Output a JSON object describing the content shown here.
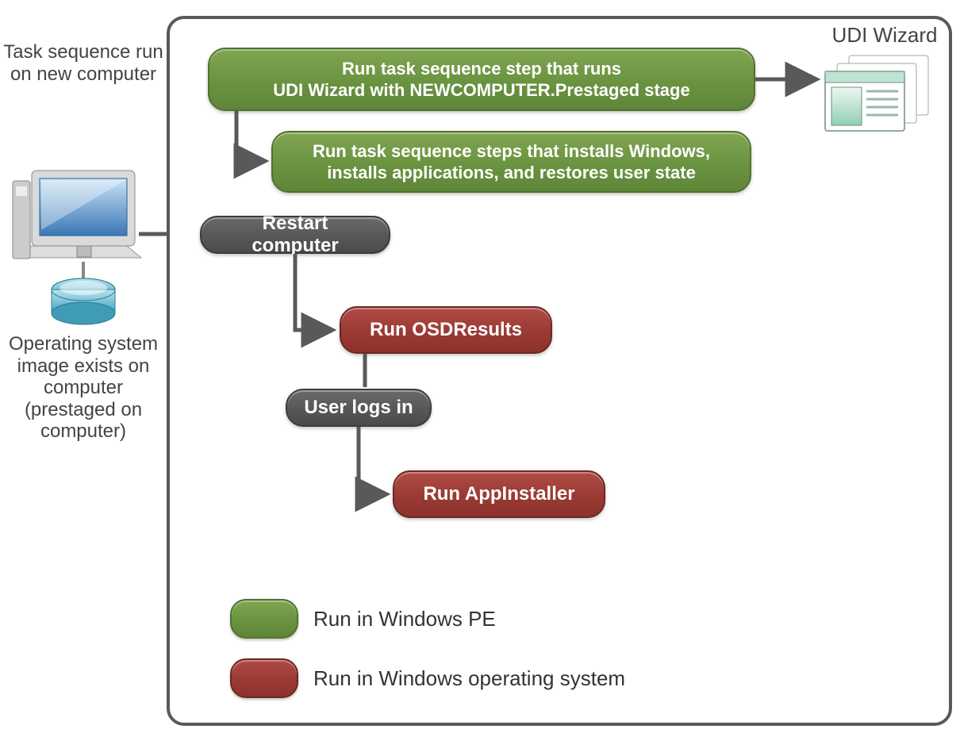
{
  "labels": {
    "task_sequence": "Task sequence run on new computer",
    "os_image": "Operating system image exists on computer (prestaged on computer)",
    "udi_wizard": "UDI Wizard"
  },
  "steps": {
    "green1_line1": "Run task sequence step  that runs",
    "green1_line2": "UDI Wizard with NEWCOMPUTER.Prestaged  stage",
    "green2_line1": "Run task sequence steps that installs Windows,",
    "green2_line2": "installs applications, and restores user state",
    "restart": "Restart computer",
    "osd": "Run OSDResults",
    "login": "User logs in",
    "appinstaller": "Run AppInstaller"
  },
  "legend": {
    "pe": "Run in Windows  PE",
    "os": "Run in Windows operating system"
  },
  "colors": {
    "green": "#6d9342",
    "gray": "#595959",
    "red": "#9a3a34"
  }
}
